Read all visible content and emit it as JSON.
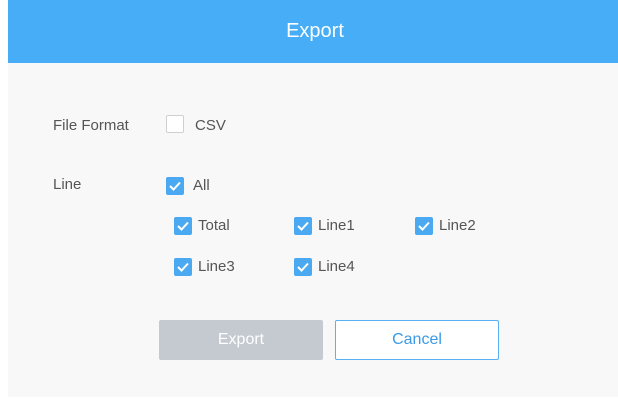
{
  "dialog": {
    "title": "Export",
    "file_format": {
      "label": "File Format",
      "options": [
        {
          "label": "CSV",
          "checked": false
        }
      ]
    },
    "line": {
      "label": "Line",
      "all": {
        "label": "All",
        "checked": true
      },
      "options": [
        {
          "label": "Total",
          "checked": true
        },
        {
          "label": "Line1",
          "checked": true
        },
        {
          "label": "Line2",
          "checked": true
        },
        {
          "label": "Line3",
          "checked": true
        },
        {
          "label": "Line4",
          "checked": true
        }
      ]
    },
    "buttons": {
      "export_label": "Export",
      "cancel_label": "Cancel"
    }
  },
  "colors": {
    "header": "#46adf6",
    "checkbox_checked": "#4aa9f0",
    "export_button": "#c5cad0",
    "cancel_border": "#59b0f2"
  }
}
